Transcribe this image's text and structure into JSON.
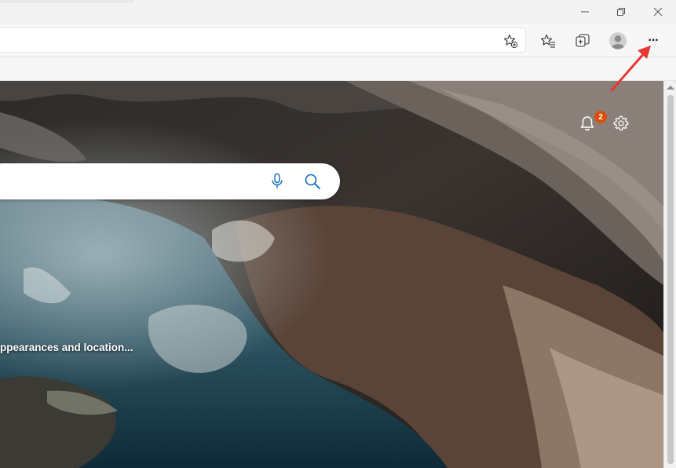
{
  "browser": {
    "window_controls": {
      "minimize_glyph": "—",
      "restore_glyph": "❐",
      "close_glyph": "✕"
    },
    "toolbar_icons": [
      "favorite-add-icon",
      "favorites-icon",
      "collections-icon",
      "profile-icon",
      "more-icon"
    ],
    "more_glyph": "···"
  },
  "page": {
    "notification_count": "2",
    "image_caption": "ppearances and location...",
    "search_icons": [
      "microphone-icon",
      "search-icon"
    ],
    "colors": {
      "accent": "#0f6cbd",
      "badge": "#d94f0a",
      "arrow": "#e53935"
    }
  }
}
